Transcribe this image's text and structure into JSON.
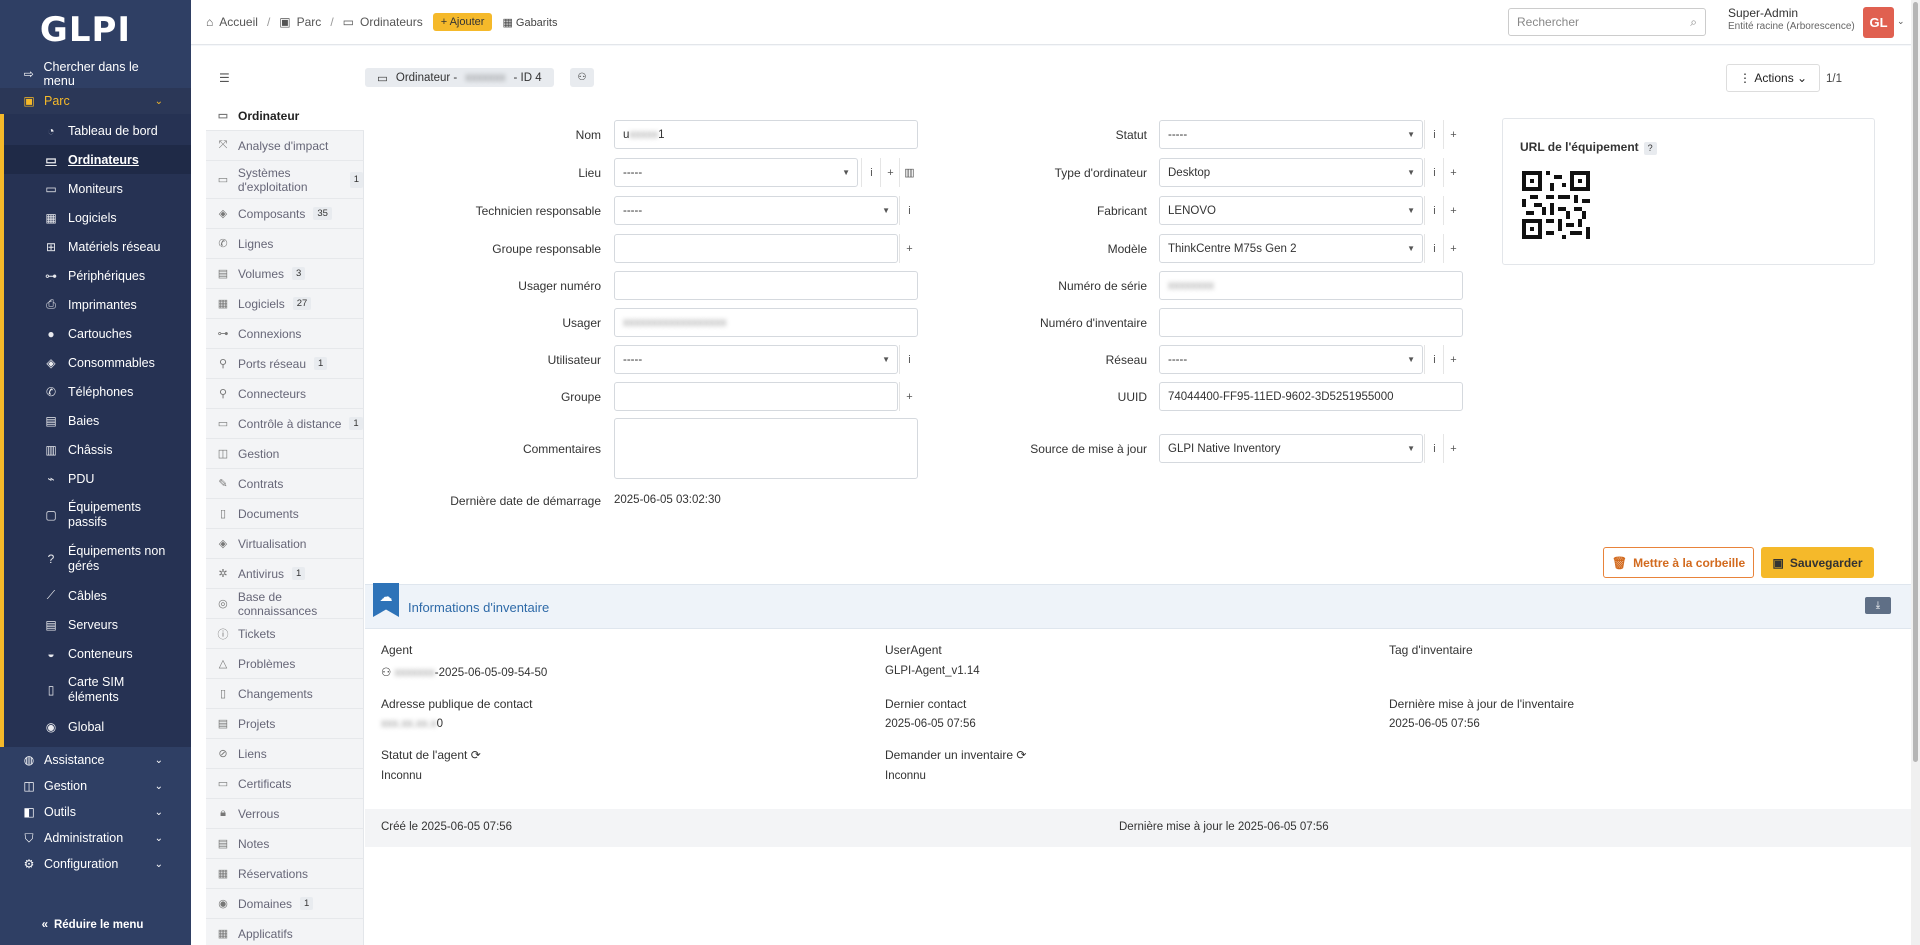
{
  "app": {
    "logo_text": "GLPI"
  },
  "sidebar": {
    "search_label": "Chercher dans le menu",
    "parc_label": "Parc",
    "parc_items": [
      {
        "label": "Tableau de bord",
        "icon": "dashboard-icon"
      },
      {
        "label": "Ordinateurs",
        "icon": "laptop-icon"
      },
      {
        "label": "Moniteurs",
        "icon": "monitor-icon"
      },
      {
        "label": "Logiciels",
        "icon": "apps-icon"
      },
      {
        "label": "Matériels réseau",
        "icon": "network-icon"
      },
      {
        "label": "Périphériques",
        "icon": "devices-icon"
      },
      {
        "label": "Imprimantes",
        "icon": "printer-icon"
      },
      {
        "label": "Cartouches",
        "icon": "droplet-icon"
      },
      {
        "label": "Consommables",
        "icon": "package-icon"
      },
      {
        "label": "Téléphones",
        "icon": "phone-icon"
      },
      {
        "label": "Baies",
        "icon": "server-icon"
      },
      {
        "label": "Châssis",
        "icon": "columns-icon"
      },
      {
        "label": "PDU",
        "icon": "plug-icon"
      },
      {
        "label": "Équipements passifs",
        "icon": "box-icon"
      },
      {
        "label": "Équipements non gérés",
        "icon": "question-icon"
      },
      {
        "label": "Câbles",
        "icon": "cable-icon"
      },
      {
        "label": "Serveurs",
        "icon": "server-icon"
      },
      {
        "label": "Conteneurs",
        "icon": "container-icon"
      },
      {
        "label": "Carte SIM éléments",
        "icon": "sim-icon"
      },
      {
        "label": "Global",
        "icon": "globe-icon"
      }
    ],
    "sections": [
      {
        "label": "Assistance",
        "icon": "headset-icon"
      },
      {
        "label": "Gestion",
        "icon": "wallet-icon"
      },
      {
        "label": "Outils",
        "icon": "briefcase-icon"
      },
      {
        "label": "Administration",
        "icon": "shield-icon"
      },
      {
        "label": "Configuration",
        "icon": "gear-icon"
      }
    ],
    "collapse_label": "Réduire le menu"
  },
  "header": {
    "breadcrumb": [
      "Accueil",
      "Parc",
      "Ordinateurs"
    ],
    "add_label": "Ajouter",
    "templates_label": "Gabarits",
    "search_placeholder": "Rechercher",
    "user_name": "Super-Admin",
    "user_entity": "Entité racine (Arborescence)",
    "avatar_initials": "GL"
  },
  "item": {
    "title_prefix": "Ordinateur -",
    "title_suffix": "- ID 4",
    "actions_label": "Actions",
    "pager": "1/1"
  },
  "tabs": [
    {
      "label": "Ordinateur"
    },
    {
      "label": "Analyse d'impact"
    },
    {
      "label": "Systèmes d'exploitation",
      "badge": "1"
    },
    {
      "label": "Composants",
      "badge": "35"
    },
    {
      "label": "Lignes"
    },
    {
      "label": "Volumes",
      "badge": "3"
    },
    {
      "label": "Logiciels",
      "badge": "27"
    },
    {
      "label": "Connexions"
    },
    {
      "label": "Ports réseau",
      "badge": "1"
    },
    {
      "label": "Connecteurs"
    },
    {
      "label": "Contrôle à distance",
      "badge": "1"
    },
    {
      "label": "Gestion"
    },
    {
      "label": "Contrats"
    },
    {
      "label": "Documents"
    },
    {
      "label": "Virtualisation"
    },
    {
      "label": "Antivirus",
      "badge": "1"
    },
    {
      "label": "Base de connaissances"
    },
    {
      "label": "Tickets"
    },
    {
      "label": "Problèmes"
    },
    {
      "label": "Changements"
    },
    {
      "label": "Projets"
    },
    {
      "label": "Liens"
    },
    {
      "label": "Certificats"
    },
    {
      "label": "Verrous"
    },
    {
      "label": "Notes"
    },
    {
      "label": "Réservations"
    },
    {
      "label": "Domaines",
      "badge": "1"
    },
    {
      "label": "Applicatifs"
    }
  ],
  "form": {
    "nom": {
      "label": "Nom",
      "value_start": "u",
      "value_end": "1"
    },
    "lieu": {
      "label": "Lieu",
      "value": "-----"
    },
    "tech": {
      "label": "Technicien responsable",
      "value": "-----"
    },
    "groupe_resp": {
      "label": "Groupe responsable",
      "value": ""
    },
    "usager_num": {
      "label": "Usager numéro",
      "value": ""
    },
    "usager": {
      "label": "Usager",
      "value": ""
    },
    "utilisateur": {
      "label": "Utilisateur",
      "value": "-----"
    },
    "groupe": {
      "label": "Groupe",
      "value": ""
    },
    "commentaires": {
      "label": "Commentaires",
      "value": ""
    },
    "last_boot": {
      "label": "Dernière date de démarrage",
      "value": "2025-06-05 03:02:30"
    },
    "statut": {
      "label": "Statut",
      "value": "-----"
    },
    "type": {
      "label": "Type d'ordinateur",
      "value": "Desktop"
    },
    "fabricant": {
      "label": "Fabricant",
      "value": "LENOVO"
    },
    "modele": {
      "label": "Modèle",
      "value": "ThinkCentre M75s Gen 2"
    },
    "serie": {
      "label": "Numéro de série",
      "value": ""
    },
    "inventaire": {
      "label": "Numéro d'inventaire",
      "value": ""
    },
    "reseau": {
      "label": "Réseau",
      "value": "-----"
    },
    "uuid": {
      "label": "UUID",
      "value": "74044400-FF95-11ED-9602-3D5251955000"
    },
    "source": {
      "label": "Source de mise à jour",
      "value": "GLPI Native Inventory"
    },
    "qr_label": "URL de l'équipement",
    "qr_help": "?"
  },
  "buttons": {
    "trash": "Mettre à la corbeille",
    "save": "Sauvegarder"
  },
  "inventory": {
    "title": "Informations d'inventaire",
    "agent_label": "Agent",
    "agent_value": "-2025-06-05-09-54-50",
    "useragent_label": "UserAgent",
    "useragent_value": "GLPI-Agent_v1.14",
    "tag_label": "Tag d'inventaire",
    "ip_label": "Adresse publique de contact",
    "ip_value_end": "0",
    "last_contact_label": "Dernier contact",
    "last_contact_value": "2025-06-05 07:56",
    "last_inv_label": "Dernière mise à jour de l'inventaire",
    "last_inv_value": "2025-06-05 07:56",
    "agent_status_label": "Statut de l'agent",
    "agent_status_value": "Inconnu",
    "request_label": "Demander un inventaire",
    "request_value": "Inconnu"
  },
  "footer": {
    "created": "Créé le 2025-06-05 07:56",
    "updated": "Dernière mise à jour le 2025-06-05 07:56"
  },
  "colors": {
    "sidebar_bg": "#2f3f64",
    "accent": "#f5b92a",
    "link_blue": "#2e6aa8",
    "danger": "#d26a1e"
  }
}
